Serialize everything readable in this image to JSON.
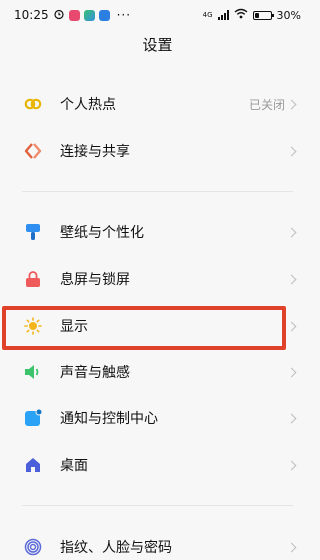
{
  "status_bar": {
    "time": "10:25",
    "overflow": "···",
    "network": "4G",
    "battery": "30%",
    "battery_level": 0.3
  },
  "header": {
    "title": "设置"
  },
  "section1": {
    "items": [
      {
        "label": "个人热点",
        "value": "已关闭",
        "icon": "hotspot-icon",
        "color": "#e8b400"
      },
      {
        "label": "连接与共享",
        "value": "",
        "icon": "connection-share-icon",
        "color": "#e0603c"
      }
    ]
  },
  "section2": {
    "items": [
      {
        "label": "壁纸与个性化",
        "icon": "wallpaper-brush-icon",
        "color": "#2f8ff0"
      },
      {
        "label": "息屏与锁屏",
        "icon": "lock-icon",
        "color": "#ef5b5b"
      },
      {
        "label": "显示",
        "icon": "sun-icon",
        "color": "#f3b51b"
      },
      {
        "label": "声音与触感",
        "icon": "speaker-icon",
        "color": "#3cc46b"
      },
      {
        "label": "通知与控制中心",
        "icon": "notification-icon",
        "color": "#2aa2f5"
      },
      {
        "label": "桌面",
        "icon": "home-icon",
        "color": "#4a5fd9"
      }
    ]
  },
  "section3": {
    "items": [
      {
        "label": "指纹、人脸与密码",
        "icon": "fingerprint-icon",
        "color": "#5b6ad8"
      }
    ]
  },
  "highlight_color": "#e0412a"
}
